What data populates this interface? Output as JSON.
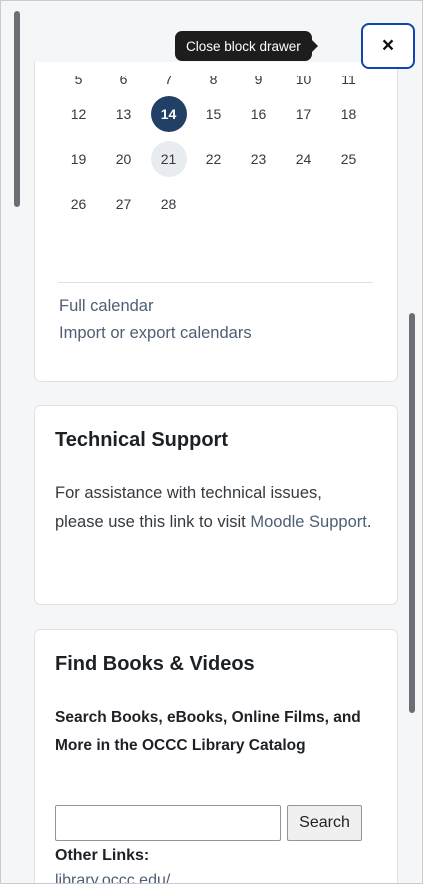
{
  "tooltip": "Close block drawer",
  "close_symbol": "×",
  "calendar": {
    "partial_row": [
      "5",
      "6",
      "7",
      "8",
      "9",
      "10",
      "11"
    ],
    "rows": [
      [
        "12",
        "13",
        "14",
        "15",
        "16",
        "17",
        "18"
      ],
      [
        "19",
        "20",
        "21",
        "22",
        "23",
        "24",
        "25"
      ],
      [
        "26",
        "27",
        "28",
        "",
        "",
        "",
        ""
      ]
    ],
    "today": "14",
    "hover_day": "21",
    "links": [
      "Full calendar",
      "Import or export calendars"
    ]
  },
  "support": {
    "title": "Technical Support",
    "text": "For assistance with technical issues, please use this link to visit ",
    "link": "Moodle Support",
    "suffix": "."
  },
  "books": {
    "title": "Find Books & Videos",
    "subtitle": "Search Books, eBooks, Online Films, and More in the OCCC Library Catalog",
    "search_value": "",
    "search_button": "Search",
    "other_links_label": "Other Links:",
    "library_link": "library.occc.edu/"
  },
  "colors": {
    "accent": "#223f66",
    "link": "#4e5f73",
    "focus_border": "#0f47ad"
  }
}
